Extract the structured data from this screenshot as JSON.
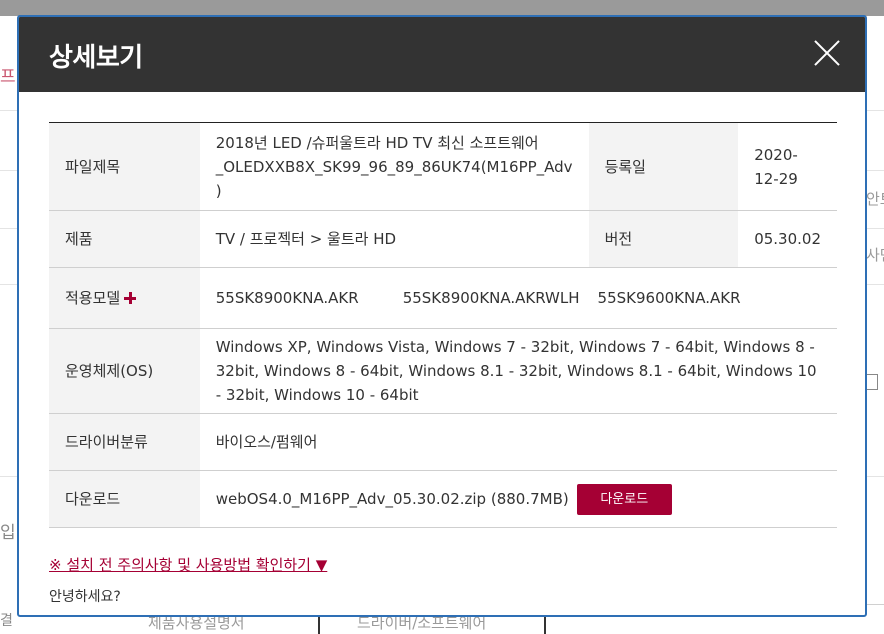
{
  "background": {
    "left_char_top": "프",
    "left_char_bottom": "입",
    "left_char_last": "결",
    "right_text_1": "안트",
    "right_text_2": "사면",
    "bottom_tab_1": "제품사용설명서",
    "bottom_tab_2": "드라이버/소프트웨어"
  },
  "modal": {
    "title": "상세보기",
    "close_label": "×",
    "rows": {
      "file_title_label": "파일제목",
      "file_title_value": "2018년 LED /슈퍼울트라 HD TV 최신 소프트웨어_OLEDXXB8X_SK99_96_89_86UK74(M16PP_Adv )",
      "registered_label": "등록일",
      "registered_value": "2020-12-29",
      "product_label": "제품",
      "product_value": "TV / 프로젝터 > 울트라 HD",
      "version_label": "버전",
      "version_value": "05.30.02",
      "models_label": "적용모델",
      "models": [
        "55SK8900KNA.AKR",
        "55SK8900KNA.AKRWLH",
        "55SK9600KNA.AKR"
      ],
      "os_label": "운영체제(OS)",
      "os_value": "Windows XP, Windows Vista, Windows 7 - 32bit, Windows 7 - 64bit, Windows 8 - 32bit, Windows 8 - 64bit, Windows 8.1 - 32bit, Windows 8.1 - 64bit, Windows 10 - 32bit, Windows 10 - 64bit",
      "driver_type_label": "드라이버분류",
      "driver_type_value": "바이오스/펌웨어",
      "download_label": "다운로드",
      "download_file": "webOS4.0_M16PP_Adv_05.30.02.zip (880.7MB)",
      "download_button": "다운로드"
    },
    "notice_link": "※ 설치 전 주의사항 및 사용방법 확인하기 ▼",
    "notice_text": "안녕하세요?"
  },
  "colors": {
    "accent": "#a50034",
    "header_bg": "#333333",
    "modal_border": "#2e6fb5"
  }
}
